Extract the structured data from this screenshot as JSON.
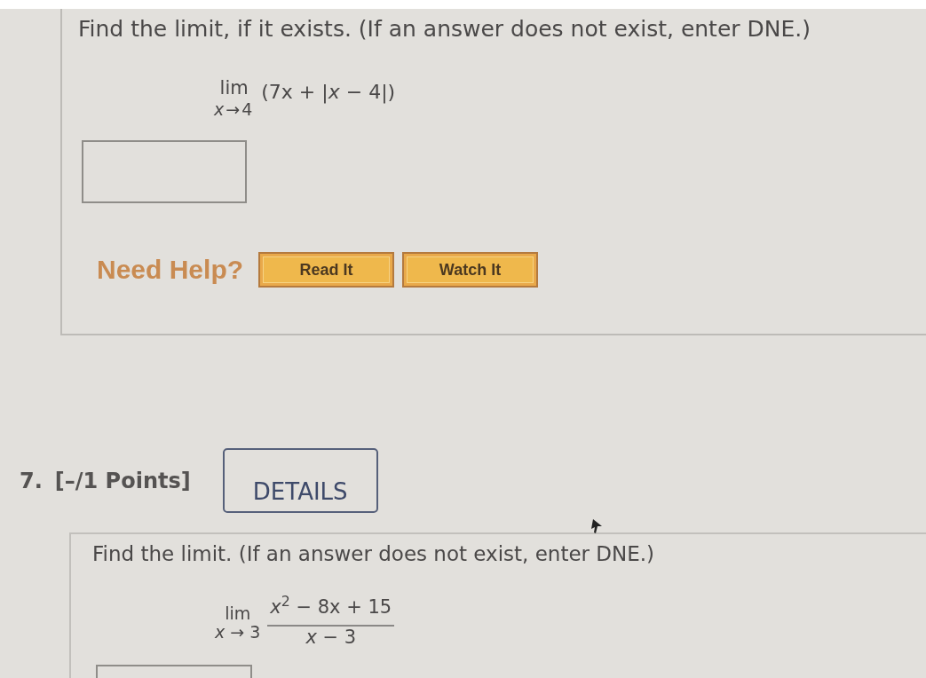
{
  "question_6": {
    "prompt": "Find the limit, if it exists. (If an answer does not exist, enter DNE.)",
    "limit": {
      "operator": "lim",
      "approach": "*x*→4",
      "expression": "(7x + |*x* − 4|)"
    },
    "help": {
      "label": "Need Help?",
      "buttons": [
        "Read It",
        "Watch It"
      ]
    }
  },
  "question_7": {
    "number": "7.",
    "points": "[–/1 Points]",
    "details_button": "DETAILS",
    "prompt": "Find the limit. (If an answer does not exist, enter DNE.)",
    "limit": {
      "operator": "lim",
      "approach": "*x* → 3",
      "numerator": "*x*$^{2}$ − 8x + 15",
      "denominator": "*x* − 3"
    }
  }
}
